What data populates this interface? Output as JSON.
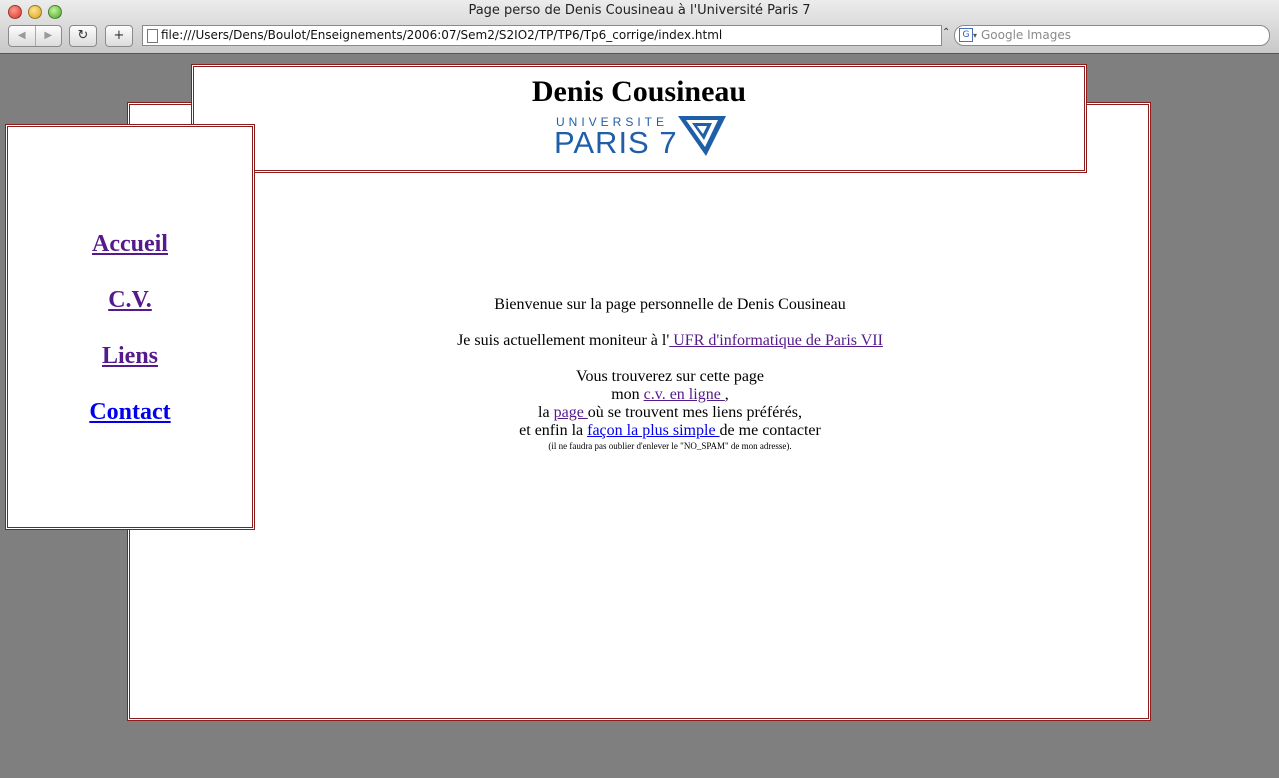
{
  "browser": {
    "window_title": "Page perso de Denis Cousineau à l'Université Paris 7",
    "back_icon": "◀",
    "forward_icon": "▶",
    "reload_icon": "↻",
    "add_icon": "+",
    "url": "file:///Users/Dens/Boulot/Enseignements/2006:07/Sem2/S2IO2/TP/TP6/Tp6_corrige/index.html",
    "bookmark_icon": "⌃",
    "search_placeholder": "Google Images",
    "search_engine_letter": "G",
    "search_caret": "▾"
  },
  "header": {
    "title": "Denis Cousineau",
    "logo_line1": "UNIVERSITE",
    "logo_line2": "PARIS 7"
  },
  "sidebar": {
    "items": [
      {
        "label": "Accueil ",
        "state": "visited"
      },
      {
        "label": "C.V. ",
        "state": "visited"
      },
      {
        "label": "Liens ",
        "state": "visited"
      },
      {
        "label": "Contact",
        "state": "unvisited"
      }
    ]
  },
  "content": {
    "welcome": "Bienvenue sur la page personnelle de Denis Cousineau",
    "moniteur_prefix": "Je suis actuellement moniteur à l'",
    "ufr_link": " UFR d'informatique de Paris VII ",
    "find_line": "Vous trouverez sur cette page",
    "mon": "mon ",
    "cv_link": "c.v. en ligne ",
    "cv_suffix": ",",
    "la": "la ",
    "page_link": "page ",
    "page_suffix": "où se trouvent mes liens préférés,",
    "enfin": "et enfin la ",
    "contact_link": "façon la plus simple ",
    "contact_suffix": "de me contacter",
    "note": "(il ne faudra pas oublier d'enlever le \"NO_SPAM\" de mon adresse)."
  },
  "colors": {
    "visited_link": "#551a8b",
    "unvisited_link": "#0000ee",
    "border": "#8b1d1d",
    "page_bg": "#7f7f7f",
    "logo_blue": "#1f5fa8"
  }
}
